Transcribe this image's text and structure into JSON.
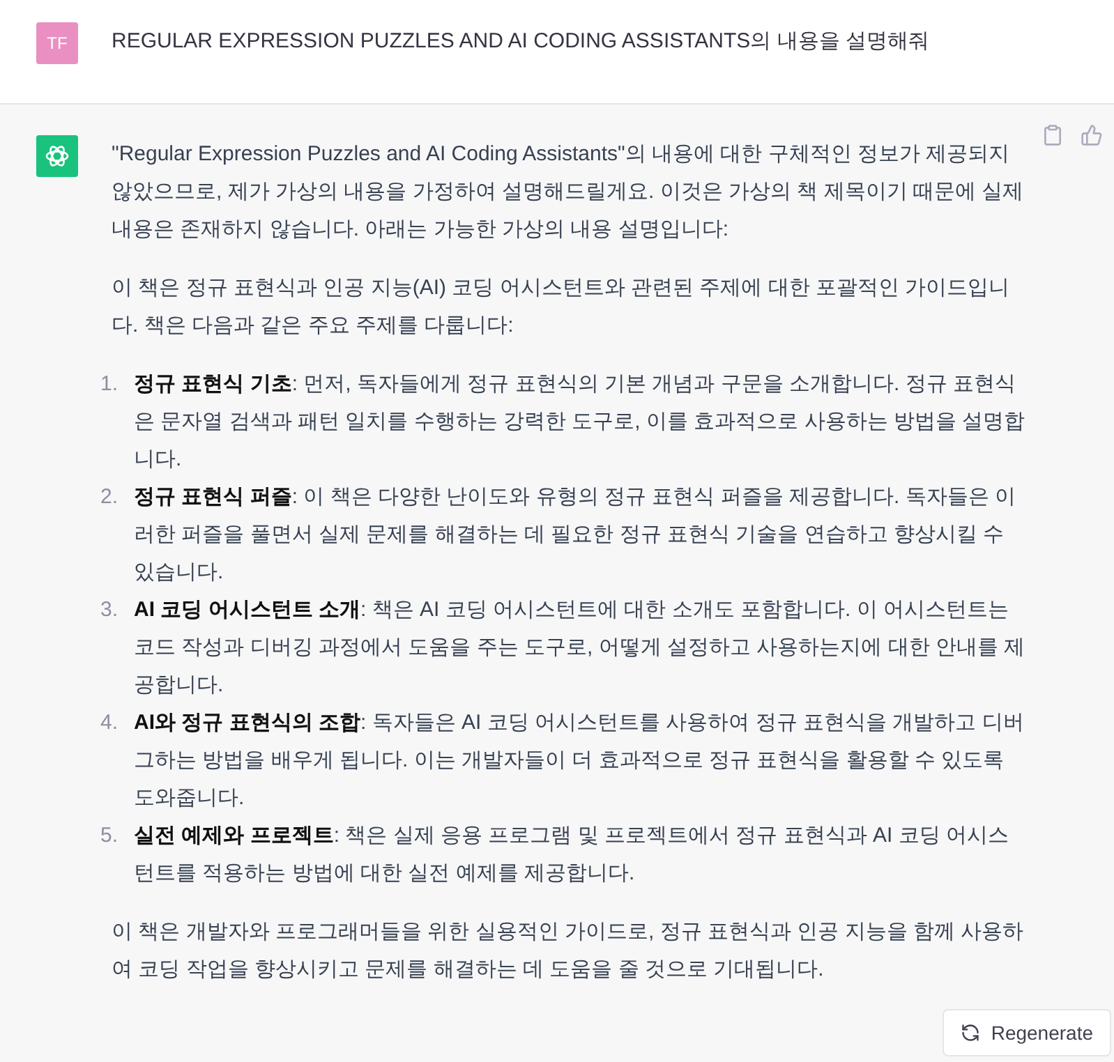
{
  "user_message": {
    "avatar": "TF",
    "text": "REGULAR EXPRESSION PUZZLES AND AI CODING ASSISTANTS의 내용을 설명해줘"
  },
  "assistant_message": {
    "paragraphs": [
      "\"Regular Expression Puzzles and AI Coding Assistants\"의 내용에 대한 구체적인 정보가 제공되지 않았으므로, 제가 가상의 내용을 가정하여 설명해드릴게요. 이것은 가상의 책 제목이기 때문에 실제 내용은 존재하지 않습니다. 아래는 가능한 가상의 내용 설명입니다:",
      "이 책은 정규 표현식과 인공 지능(AI) 코딩 어시스턴트와 관련된 주제에 대한 포괄적인 가이드입니다. 책은 다음과 같은 주요 주제를 다룹니다:"
    ],
    "list": [
      {
        "number": "1.",
        "text": "**정규 표현식 기초**: 먼저, 독자들에게 정규 표현식의 기본 개념과 구문을 소개합니다. 정규 표현식은 문자열 검색과 패턴 일치를 수행하는 강력한 도구로, 이를 효과적으로 사용하는 방법을 설명합니다."
      },
      {
        "number": "2.",
        "text": "**정규 표현식 퍼즐**: 이 책은 다양한 난이도와 유형의 정규 표현식 퍼즐을 제공합니다. 독자들은 이러한 퍼즐을 풀면서 실제 문제를 해결하는 데 필요한 정규 표현식 기술을 연습하고 향상시킬 수 있습니다."
      },
      {
        "number": "3.",
        "text": "**AI 코딩 어시스턴트 소개**: 책은 AI 코딩 어시스턴트에 대한 소개도 포함합니다. 이 어시스턴트는 코드 작성과 디버깅 과정에서 도움을 주는 도구로, 어떻게 설정하고 사용하는지에 대한 안내를 제공합니다."
      },
      {
        "number": "4.",
        "text": "**AI와 정규 표현식의 조합**: 독자들은 AI 코딩 어시스턴트를 사용하여 정규 표현식을 개발하고 디버그하는 방법을 배우게 됩니다. 이는 개발자들이 더 효과적으로 정규 표현식을 활용할 수 있도록 도와줍니다."
      },
      {
        "number": "5.",
        "text": "**실전 예제와 프로젝트**: 책은 실제 응용 프로그램 및 프로젝트에서 정규 표현식과 AI 코딩 어시스턴트를 적용하는 방법에 대한 실전 예제를 제공합니다."
      }
    ],
    "closing": "이 책은 개발자와 프로그래머들을 위한 실용적인 가이드로, 정규 표현식과 인공 지능을 함께 사용하여 코딩 작업을 향상시키고 문제를 해결하는 데 도움을 줄 것으로 기대됩니다."
  },
  "regenerate_button": {
    "label": "Regenerate"
  }
}
